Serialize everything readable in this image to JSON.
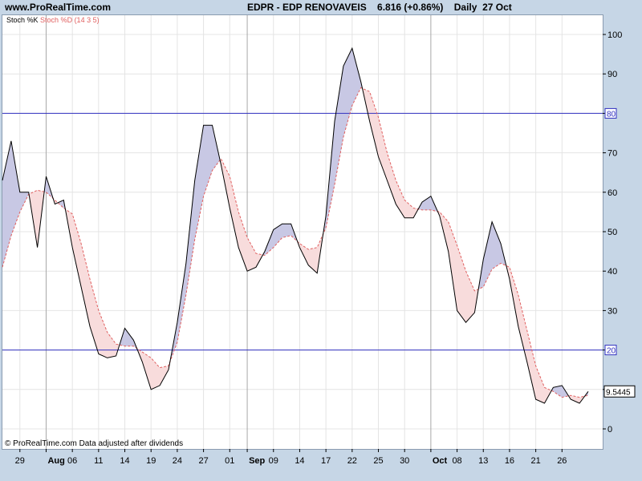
{
  "header": {
    "site": "www.ProRealTime.com",
    "title": "EDPR - EDP RENOVAVEIS    6.816 (+0.86%)    Daily  27 Oct"
  },
  "legend": {
    "k_label": "Stoch %K",
    "d_label": "Stoch %D (14 3 5)"
  },
  "footer": "© ProRealTime.com  Data adjusted after dividends",
  "colors": {
    "background": "#c6d6e6",
    "plot_background": "#ffffff",
    "k_line": "#000000",
    "d_line": "#e06060",
    "fill_k_above": "#c8c8e4",
    "fill_d_above": "#f8dcdc",
    "level_lines": "#3030c0",
    "grid": "#e4e4e4"
  },
  "chart_data": {
    "type": "line",
    "title": "EDPR - EDP RENOVAVEIS",
    "x_tick_labels": [
      "29",
      "Aug",
      "06",
      "11",
      "14",
      "19",
      "24",
      "27",
      "01",
      "Sep",
      "09",
      "14",
      "17",
      "22",
      "25",
      "30",
      "Oct",
      "08",
      "13",
      "16",
      "21",
      "26"
    ],
    "x_tick_index": [
      2,
      5,
      8,
      11,
      14,
      17,
      20,
      23,
      26,
      28,
      31,
      34,
      37,
      40,
      43,
      46,
      49,
      52,
      55,
      58,
      61,
      64
    ],
    "ylim": [
      -5,
      105
    ],
    "yticks": [
      0,
      10,
      20,
      30,
      40,
      50,
      60,
      70,
      80,
      90,
      100
    ],
    "ytick_labels": [
      "0",
      "",
      "20",
      "30",
      "40",
      "50",
      "60",
      "70",
      "80",
      "90",
      "100"
    ],
    "levels": [
      80,
      20
    ],
    "level_labels": [
      "80",
      "20"
    ],
    "last_value_label": "9.5445",
    "series": [
      {
        "name": "Stoch %K",
        "values": [
          63,
          73,
          60,
          60,
          46,
          64,
          57,
          58,
          46,
          36,
          26,
          19,
          18,
          18.5,
          25.5,
          22.5,
          17,
          10,
          11,
          15,
          27,
          42,
          63,
          77,
          77,
          67,
          56,
          46,
          40,
          41,
          45,
          50.5,
          52,
          52,
          46,
          41.5,
          39.5,
          54,
          78,
          92,
          96.5,
          88,
          78,
          69,
          63,
          57,
          53.5,
          53.5,
          57.5,
          59,
          54,
          45,
          30,
          27,
          29.5,
          43,
          52.5,
          47,
          38,
          26,
          17,
          7.5,
          6.5,
          10.5,
          11,
          7.5,
          6.5,
          9.5
        ]
      },
      {
        "name": "Stoch %D (14 3 5)",
        "values": [
          41,
          49,
          55,
          59.5,
          60.5,
          60,
          58,
          56,
          54.5,
          47,
          38,
          30,
          24.5,
          21.5,
          21,
          21,
          19.5,
          18,
          15.5,
          16,
          22,
          34,
          48,
          59,
          65.5,
          68.5,
          64,
          55,
          48.5,
          44.5,
          44,
          46,
          48.5,
          49,
          47,
          45.5,
          46,
          51,
          62,
          74,
          82,
          86.5,
          85.5,
          79,
          70,
          63,
          58,
          56,
          55.5,
          55.5,
          55,
          52.5,
          46.5,
          40,
          35,
          36,
          40.5,
          42,
          41,
          34,
          25,
          16,
          10.5,
          9.5,
          8,
          8.5,
          8,
          8.5
        ]
      }
    ]
  }
}
